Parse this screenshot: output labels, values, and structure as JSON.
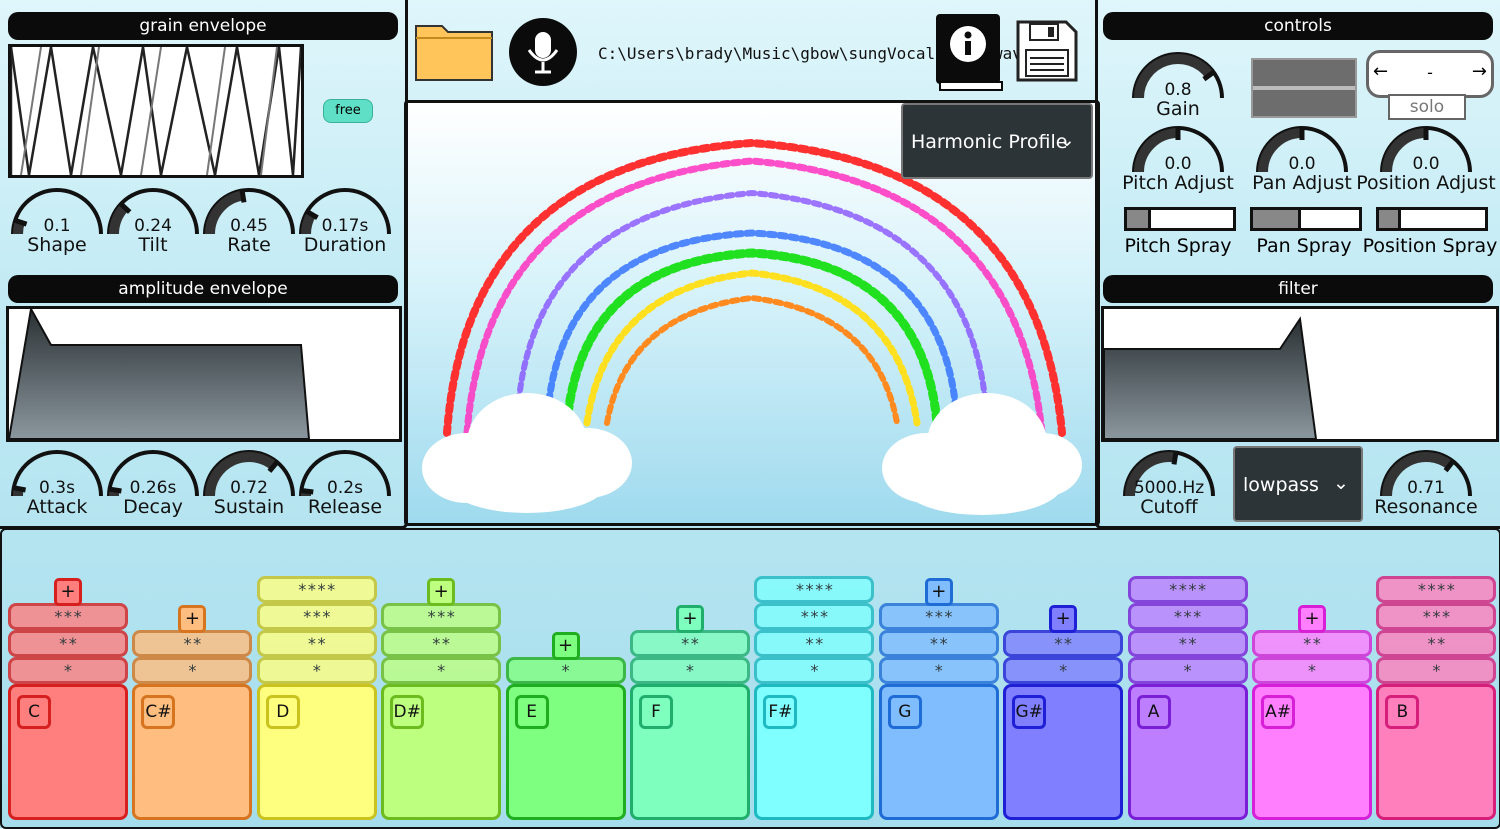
{
  "grain": {
    "header": "grain envelope",
    "free_label": "free",
    "knobs": [
      {
        "label": "Shape",
        "value": "0.1",
        "level": 0.1
      },
      {
        "label": "Tilt",
        "value": "0.24",
        "level": 0.24
      },
      {
        "label": "Rate",
        "value": "0.45",
        "level": 0.45
      },
      {
        "label": "Duration",
        "value": "0.17s",
        "level": 0.17
      }
    ]
  },
  "amplitude": {
    "header": "amplitude envelope",
    "knobs": [
      {
        "label": "Attack",
        "value": "0.3s",
        "level": 0.06
      },
      {
        "label": "Decay",
        "value": "0.26s",
        "level": 0.05
      },
      {
        "label": "Sustain",
        "value": "0.72",
        "level": 0.72
      },
      {
        "label": "Release",
        "value": "0.2s",
        "level": 0.04
      }
    ]
  },
  "toolbar": {
    "file_path": "C:\\Users\\brady\\Music\\gbow\\sungVocalsTest.wav",
    "icons": [
      "folder-icon",
      "microphone-icon",
      "info-book-icon",
      "save-floppy-icon"
    ]
  },
  "visualizer": {
    "view_mode": "Harmonic Profile"
  },
  "controls": {
    "header": "controls",
    "gain": {
      "label": "Gain",
      "value": "0.8",
      "level": 0.8
    },
    "solo": {
      "value": "-",
      "label": "solo"
    },
    "adjust_knobs": [
      {
        "label": "Pitch Adjust",
        "value": "0.0",
        "level": 0.5
      },
      {
        "label": "Pan Adjust",
        "value": "0.0",
        "level": 0.5
      },
      {
        "label": "Position Adjust",
        "value": "0.0",
        "level": 0.5
      }
    ],
    "sprays": [
      {
        "label": "Pitch Spray",
        "level": 0.2
      },
      {
        "label": "Pan Spray",
        "level": 0.42
      },
      {
        "label": "Position Spray",
        "level": 0.18
      }
    ]
  },
  "filter": {
    "header": "filter",
    "cutoff": {
      "label": "Cutoff",
      "value": "5000.Hz",
      "level": 0.55
    },
    "type": "lowpass",
    "resonance": {
      "label": "Resonance",
      "value": "0.71",
      "level": 0.71
    }
  },
  "keys": [
    {
      "note": "C",
      "stars": 3,
      "color": "#ff7f7f",
      "border": "#d61f1f"
    },
    {
      "note": "C#",
      "stars": 2,
      "color": "#ffbd7f",
      "border": "#d6741f"
    },
    {
      "note": "D",
      "stars": 4,
      "color": "#ffff7f",
      "border": "#c9c21f"
    },
    {
      "note": "D#",
      "stars": 3,
      "color": "#bdff7f",
      "border": "#6cbb1f"
    },
    {
      "note": "E",
      "stars": 1,
      "color": "#7fff7f",
      "border": "#1fae1f"
    },
    {
      "note": "F",
      "stars": 2,
      "color": "#7fffbd",
      "border": "#1fae6c"
    },
    {
      "note": "F#",
      "stars": 4,
      "color": "#7fffff",
      "border": "#1fb9c2"
    },
    {
      "note": "G",
      "stars": 3,
      "color": "#7fbdff",
      "border": "#1f6cd6"
    },
    {
      "note": "G#",
      "stars": 2,
      "color": "#7f7fff",
      "border": "#1f1fd6"
    },
    {
      "note": "A",
      "stars": 4,
      "color": "#bd7fff",
      "border": "#7a1fd6"
    },
    {
      "note": "A#",
      "stars": 2,
      "color": "#ff7fff",
      "border": "#d61fd6"
    },
    {
      "note": "B",
      "stars": 4,
      "color": "#ff7fbd",
      "border": "#d61f7a"
    }
  ],
  "star_labels": [
    "*",
    "**",
    "***",
    "****"
  ],
  "plus_label": "+"
}
